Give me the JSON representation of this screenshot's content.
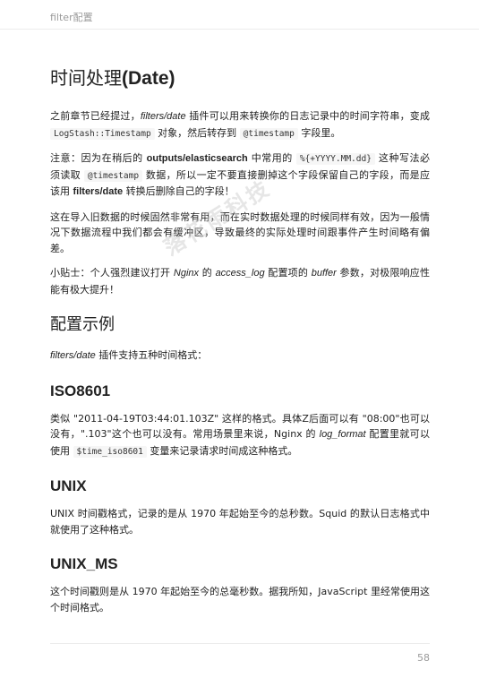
{
  "header": {
    "title": "filter配置"
  },
  "h1": {
    "cn": "时间处理",
    "latin": "(Date)"
  },
  "p1": {
    "t1": "之前章节已经提过，",
    "i1": "filters/date",
    "t2": " 插件可以用来转换你的日志记录中的时间字符串，变成 ",
    "c1": "LogStash::Timestamp",
    "t3": " 对象，然后转存到 ",
    "c2": "@timestamp",
    "t4": " 字段里。"
  },
  "p2": {
    "t1": "注意：因为在稍后的 ",
    "b1": "outputs/elasticsearch",
    "t2": " 中常用的 ",
    "c1": "%{+YYYY.MM.dd}",
    "t3": " 这种写法必须读取 ",
    "c2": "@timestamp",
    "t4": " 数据，所以一定不要直接删掉这个字段保留自己的字段，而是应该用 ",
    "b2": "filters/date",
    "t5": " 转换后删除自己的字段！"
  },
  "p3": {
    "text": "这在导入旧数据的时候固然非常有用，而在实时数据处理的时候同样有效，因为一般情况下数据流程中我们都会有缓冲区，导致最终的实际处理时间跟事件产生时间略有偏差。"
  },
  "p4": {
    "t1": "小贴士：个人强烈建议打开 ",
    "i1": "Nginx",
    "t2": " 的 ",
    "i2": "access_log",
    "t3": " 配置项的 ",
    "i3": "buffer",
    "t4": " 参数，对极限响应性能有极大提升！"
  },
  "h2": {
    "title": "配置示例"
  },
  "p5": {
    "i1": "filters/date",
    "t1": " 插件支持五种时间格式："
  },
  "iso": {
    "title": "ISO8601",
    "t1": "类似 \"2011-04-19T03:44:01.103Z\" 这样的格式。具体Z后面可以有 \"08:00\"也可以没有，\".103\"这个也可以没有。常用场景里来说，Nginx 的 ",
    "i1": "log_format",
    "t2": " 配置里就可以使用 ",
    "c1": "$time_iso8601",
    "t3": " 变量来记录请求时间成这种格式。"
  },
  "unix": {
    "title": "UNIX",
    "text": "UNIX 时间戳格式，记录的是从 1970 年起始至今的总秒数。Squid 的默认日志格式中就使用了这种格式。"
  },
  "unix_ms": {
    "title": "UNIX_MS",
    "text": "这个时间戳则是从 1970 年起始至今的总毫秒数。据我所知，JavaScript 里经常使用这个时间格式。"
  },
  "watermark": {
    "text": "落花雨科技"
  },
  "footer": {
    "page_number": "58"
  }
}
